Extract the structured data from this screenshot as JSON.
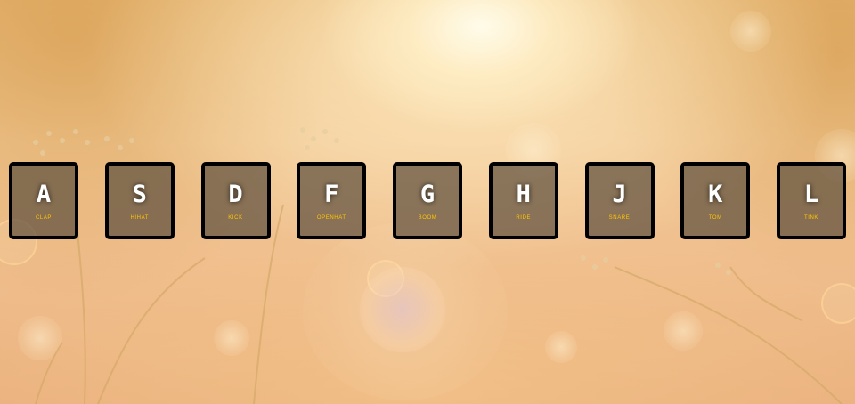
{
  "keys": [
    {
      "letter": "A",
      "sound": "clap"
    },
    {
      "letter": "S",
      "sound": "hihat"
    },
    {
      "letter": "D",
      "sound": "kick"
    },
    {
      "letter": "F",
      "sound": "openhat"
    },
    {
      "letter": "G",
      "sound": "boom"
    },
    {
      "letter": "H",
      "sound": "ride"
    },
    {
      "letter": "J",
      "sound": "snare"
    },
    {
      "letter": "K",
      "sound": "tom"
    },
    {
      "letter": "L",
      "sound": "tink"
    }
  ],
  "colors": {
    "key_border": "#000000",
    "key_fill": "#5f503e",
    "letter_text": "#ffffff",
    "sound_text": "#ffc600"
  }
}
